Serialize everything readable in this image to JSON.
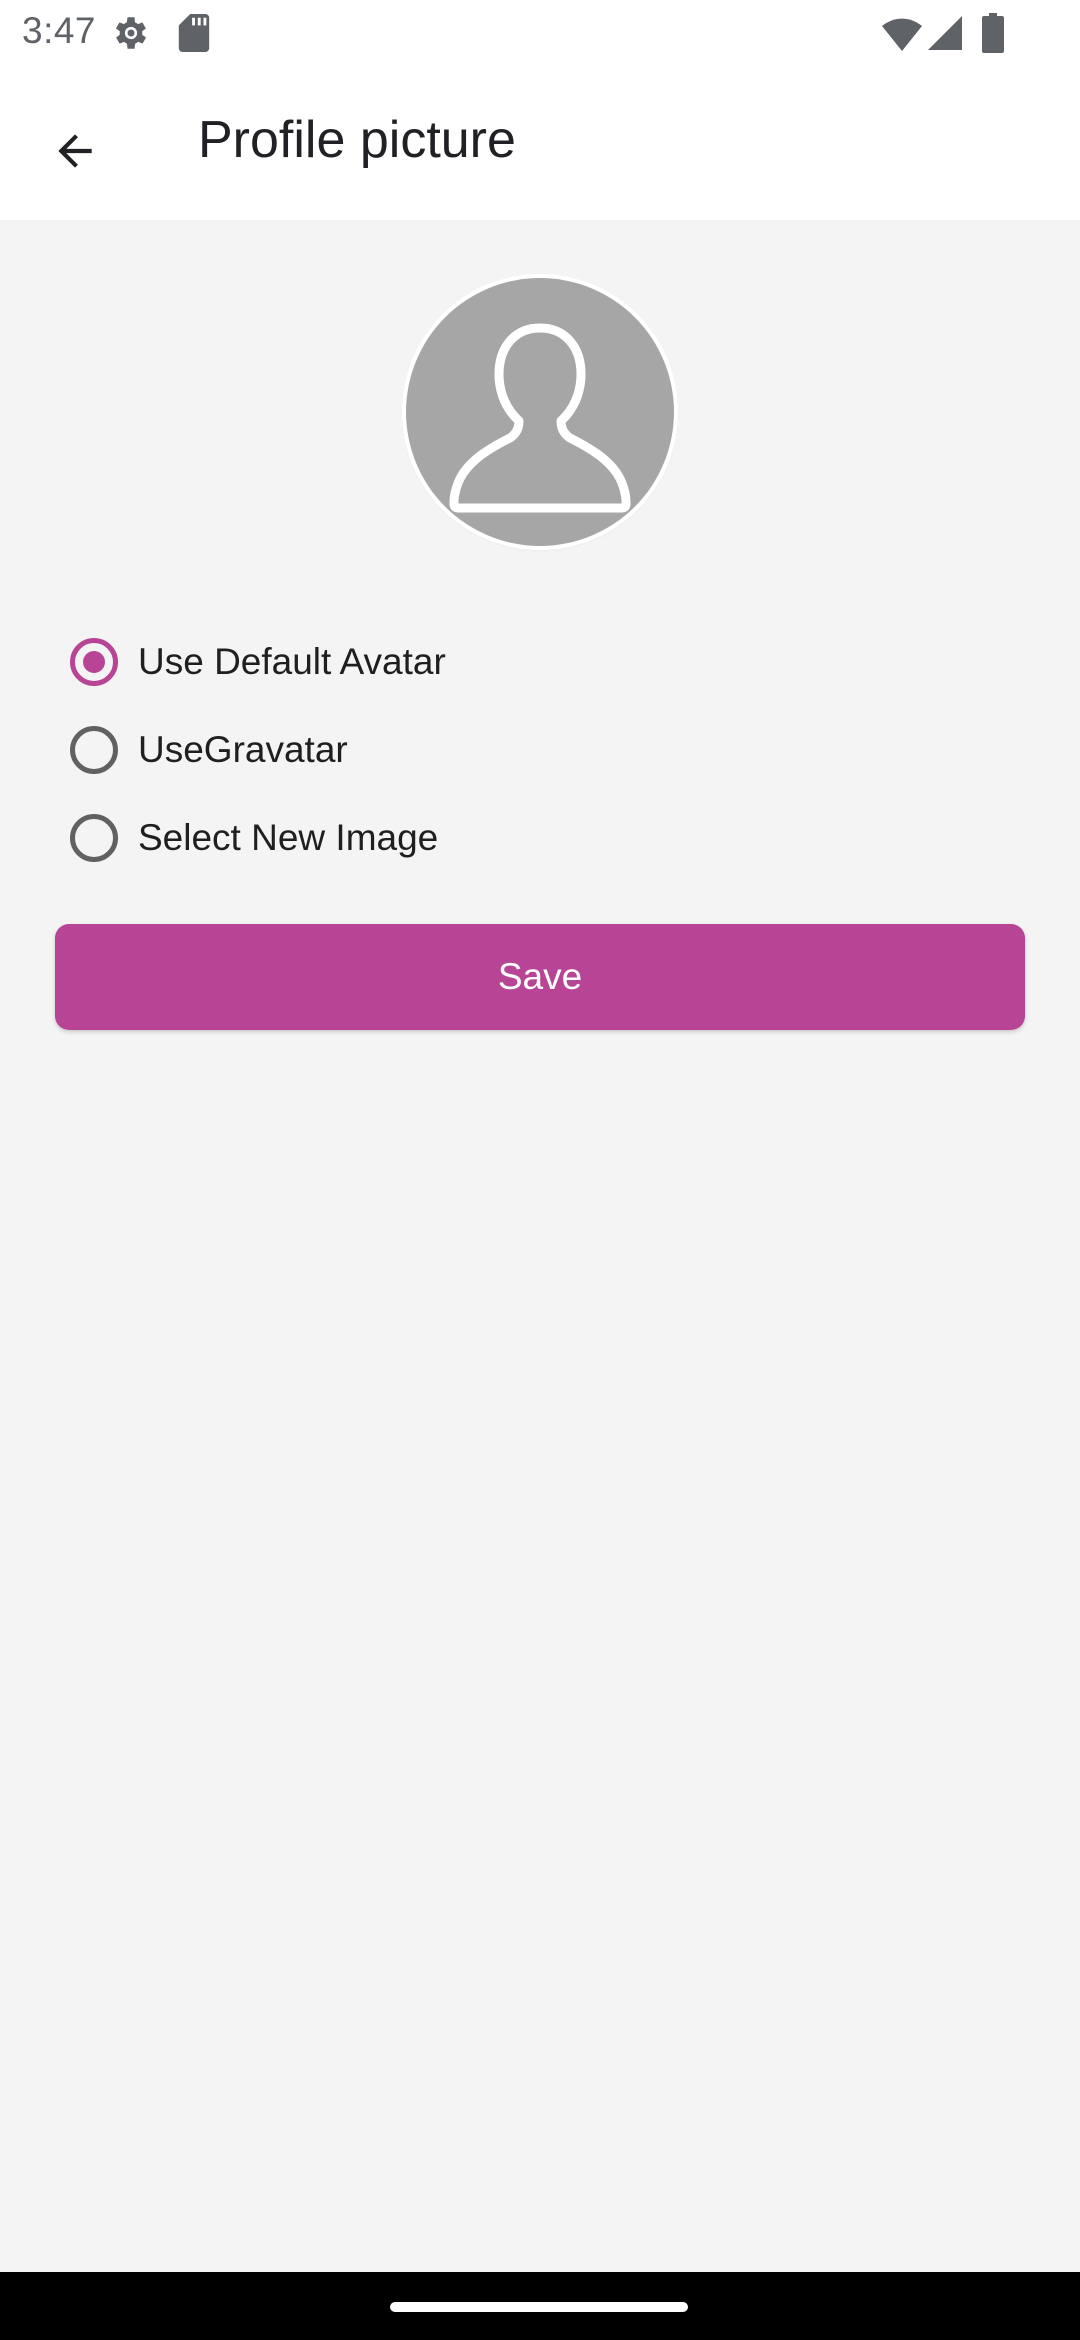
{
  "status_bar": {
    "time": "3:47",
    "icons": [
      "gear-icon",
      "sd-card-icon",
      "wifi-icon",
      "cell-signal-icon",
      "battery-icon"
    ]
  },
  "app_bar": {
    "back_icon": "arrow-back-icon",
    "title": "Profile picture"
  },
  "avatar": {
    "icon": "person-outline-icon"
  },
  "options": [
    {
      "label": "Use Default Avatar",
      "selected": true
    },
    {
      "label": "UseGravatar",
      "selected": false
    },
    {
      "label": "Select New Image",
      "selected": false
    }
  ],
  "save_label": "Save",
  "colors": {
    "accent": "#b84495",
    "background": "#f4f4f4",
    "app_bar": "#ffffff",
    "avatar_bg": "#a6a6a6"
  }
}
